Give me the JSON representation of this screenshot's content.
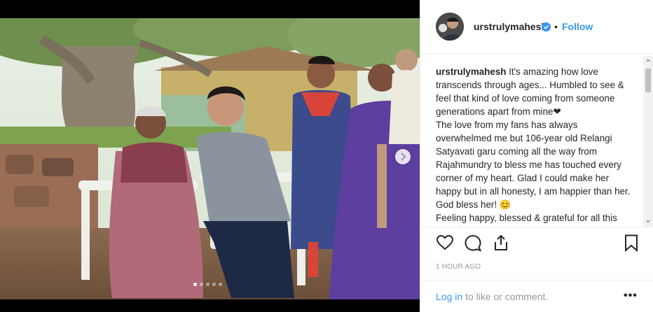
{
  "post": {
    "username": "urstrulymahesh",
    "follow_label": "Follow",
    "separator": "•",
    "caption_username": "urstrulymahesh",
    "caption_text": " It's amazing how love transcends through ages... Humbled to see & feel that kind of love coming from someone generations apart from mine❤\nThe love from my fans has always overwhelmed me but 106-year old Relangi Satyavati garu coming all the way from Rajahmundry to bless me has touched every corner of my heart. Glad I could make her happy but in all honesty, I am happier than her. God bless her! 😊\nFeeling happy, blessed & grateful for all this love🙏",
    "timestamp": "1 HOUR AGO",
    "login_link": "Log in",
    "login_rest": " to like or comment.",
    "more_label": "•••"
  },
  "carousel": {
    "slides": 5,
    "active": 0
  },
  "icons": [
    "heart-icon",
    "comment-icon",
    "share-icon",
    "bookmark-icon",
    "verified-badge-icon",
    "next-arrow-icon",
    "more-options-icon"
  ],
  "colors": {
    "accent": "#3897f0",
    "text": "#262626",
    "muted": "#999999",
    "verified": "#3897f0"
  }
}
